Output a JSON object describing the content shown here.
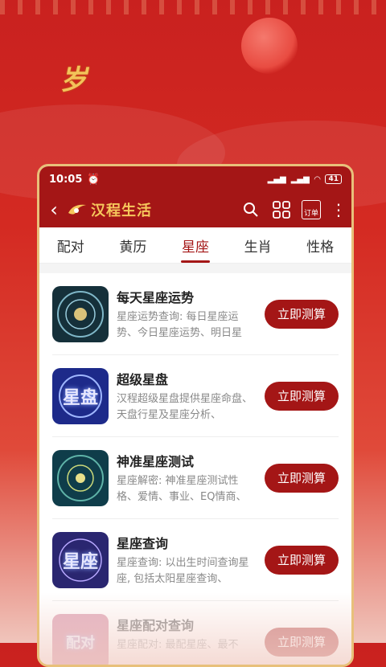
{
  "deco": {
    "logo_glyph": "岁"
  },
  "status": {
    "time": "10:05",
    "battery": "41"
  },
  "appbar": {
    "brand": "汉程生活",
    "order_label": "订单"
  },
  "tabs": [
    {
      "label": "配对",
      "active": false
    },
    {
      "label": "黄历",
      "active": false
    },
    {
      "label": "星座",
      "active": true
    },
    {
      "label": "生肖",
      "active": false
    },
    {
      "label": "性格",
      "active": false
    }
  ],
  "items": [
    {
      "title": "每天星座运势",
      "desc": "星座运势查询: 每日星座运势、今日星座运势、明日星",
      "button": "立即测算",
      "thumb_text": ""
    },
    {
      "title": "超级星盘",
      "desc": "汉程超级星盘提供星座命盘、天盘行星及星座分析、",
      "button": "立即测算",
      "thumb_text": "星盘"
    },
    {
      "title": "神准星座测试",
      "desc": "星座解密: 神准星座测试性格、爱情、事业、EQ情商、",
      "button": "立即测算",
      "thumb_text": ""
    },
    {
      "title": "星座查询",
      "desc": "星座查询: 以出生时间查询星座, 包括太阳星座查询、",
      "button": "立即测算",
      "thumb_text": "星座"
    },
    {
      "title": "星座配对查询",
      "desc": "星座配对: 最配星座、最不",
      "button": "立即测算",
      "thumb_text": "配对"
    }
  ],
  "colors": {
    "primary": "#a41616",
    "gold": "#f6c75c"
  }
}
